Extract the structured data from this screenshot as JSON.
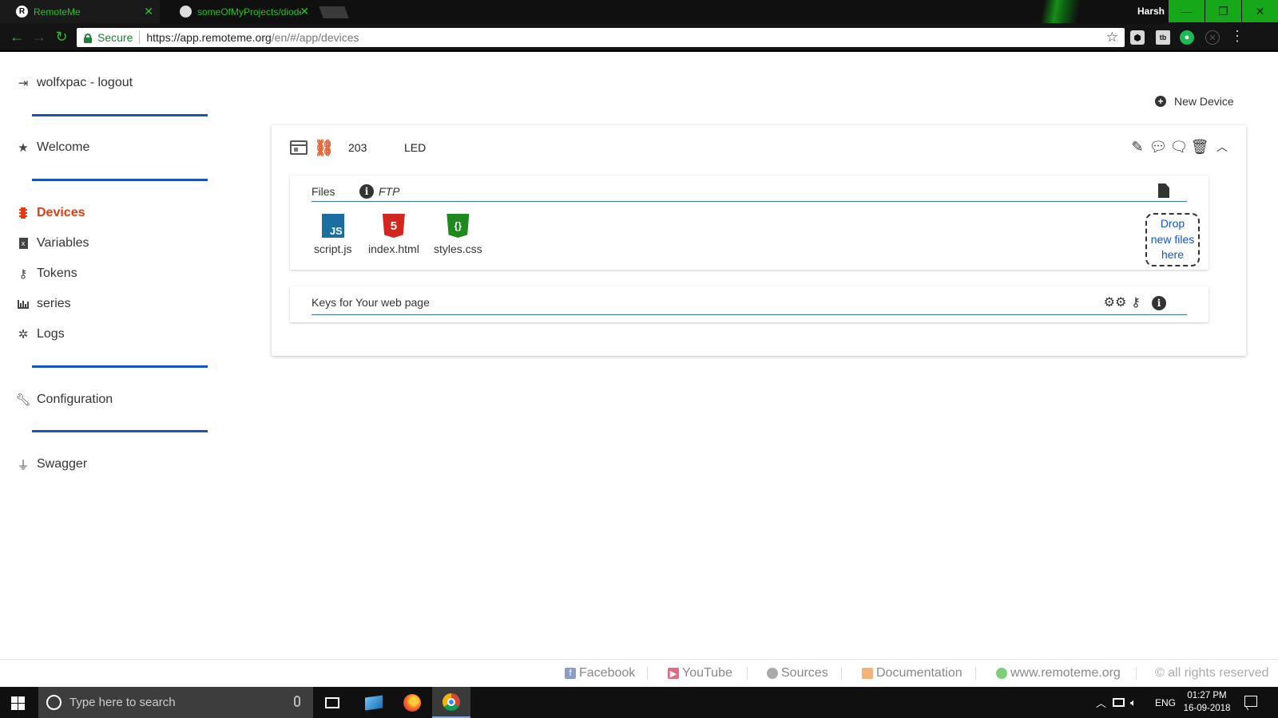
{
  "browser": {
    "tabs": [
      {
        "title": "RemoteMe",
        "favicon": "R"
      },
      {
        "title": "someOfMyProjects/diode"
      }
    ],
    "user": "Harsh",
    "secure_label": "Secure",
    "url_host": "https://app.remoteme.org",
    "url_path": "/en/#/app/devices",
    "accent": "#22c32a"
  },
  "sidebar": {
    "user_logout": "wolfxpac - logout",
    "items": [
      {
        "label": "Welcome",
        "icon": "star-icon"
      },
      {
        "label": "Devices",
        "icon": "microchip-icon",
        "active": true
      },
      {
        "label": "Variables",
        "icon": "variable-file-icon"
      },
      {
        "label": "Tokens",
        "icon": "key-icon"
      },
      {
        "label": "series",
        "icon": "bar-chart-icon"
      },
      {
        "label": "Logs",
        "icon": "bug-icon"
      },
      {
        "label": "Configuration",
        "icon": "wrench-icon"
      },
      {
        "label": "Swagger",
        "icon": "plug-icon"
      }
    ],
    "active_color": "#e53b11",
    "divider_color": "#1553c6"
  },
  "main": {
    "new_device_label": "New Device",
    "device": {
      "id": "203",
      "name": "LED",
      "files_panel": {
        "title": "Files",
        "ftp_label": "FTP",
        "files": [
          {
            "name": "script.js",
            "icon_text": "JS"
          },
          {
            "name": "index.html",
            "icon_text": "5"
          },
          {
            "name": "styles.css",
            "icon_text": "{}"
          }
        ],
        "drop_zone": [
          "Drop",
          "new files",
          "here"
        ]
      },
      "keys_panel": {
        "title": "Keys for Your web page"
      }
    }
  },
  "footer": {
    "links": [
      "Facebook",
      "YouTube",
      "Sources",
      "Documentation",
      "www.remoteme.org"
    ],
    "copyright": "© all rights reserved"
  },
  "taskbar": {
    "search_placeholder": "Type here to search",
    "language": "ENG",
    "time": "01:27 PM",
    "date": "16-09-2018"
  }
}
